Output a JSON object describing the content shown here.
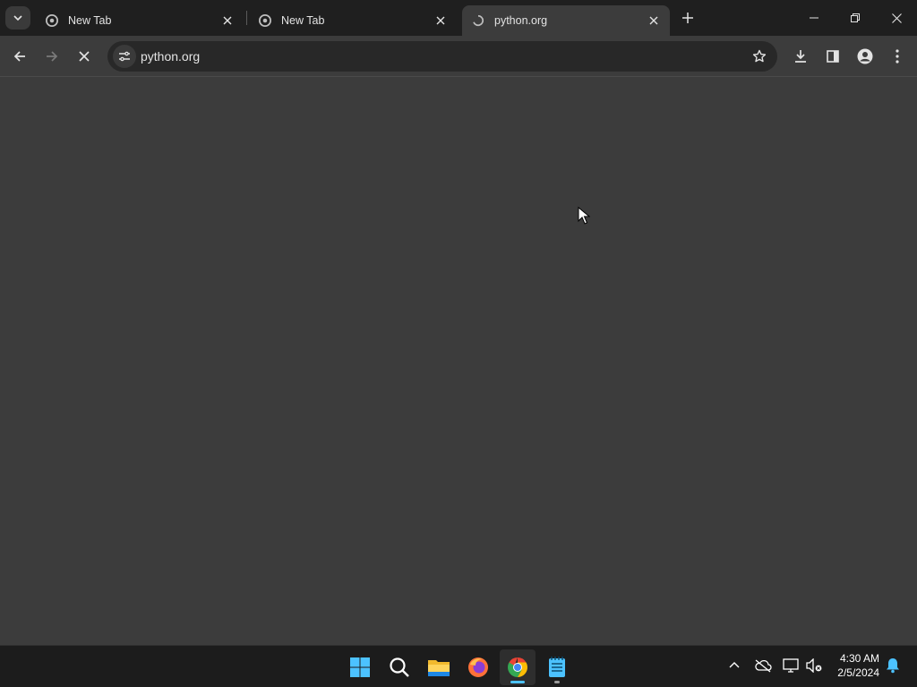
{
  "browser": {
    "tabs": [
      {
        "title": "New Tab",
        "favicon": "chrome-icon"
      },
      {
        "title": "New Tab",
        "favicon": "chrome-icon"
      },
      {
        "title": "python.org",
        "favicon": "loading-icon",
        "active": true
      }
    ],
    "address_bar": {
      "url": "python.org"
    },
    "window_controls": [
      "minimize",
      "restore",
      "close"
    ]
  },
  "taskbar": {
    "apps": [
      "start",
      "search",
      "file-explorer",
      "firefox",
      "chrome",
      "notepad"
    ],
    "active_app": "chrome",
    "clock": {
      "time": "4:30 AM",
      "date": "2/5/2024"
    }
  },
  "colors": {
    "tabstrip_bg": "#1f1f1f",
    "toolbar_bg": "#3c3c3c",
    "content_bg": "#3c3c3c",
    "omnibox_bg": "#282828",
    "taskbar_bg": "#1c1c1c",
    "accent": "#4cc2ff"
  }
}
